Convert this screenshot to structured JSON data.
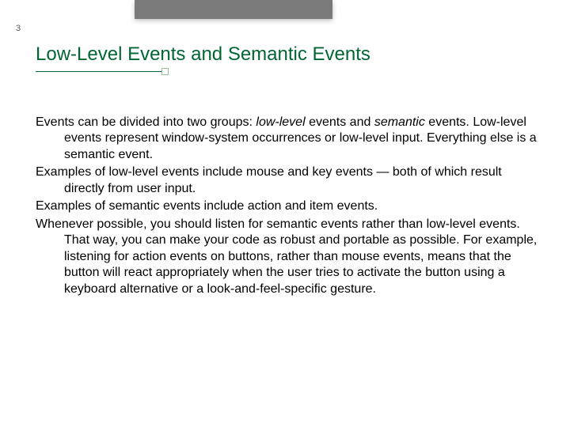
{
  "pageNumber": "3",
  "title": "Low-Level Events and Semantic Events",
  "body": {
    "p1a": "Events can be divided into two groups: ",
    "p1i1": "low-level",
    "p1b": " events and ",
    "p1i2": "semantic",
    "p1c": " events. Low-level events represent window-system occurrences or low-level input. Everything else is a semantic event.",
    "p2": "Examples of low-level events include mouse and key events — both of which result directly from user input.",
    "p3": "Examples of semantic events include action and item events.",
    "p4": "Whenever possible, you should listen for semantic events rather than low-level events. That way, you can make your code as robust and portable as possible. For example, listening for action events on buttons, rather than mouse events, means that the button will react appropriately when the user tries to activate the button using a keyboard alternative or a look-and-feel-specific gesture."
  }
}
